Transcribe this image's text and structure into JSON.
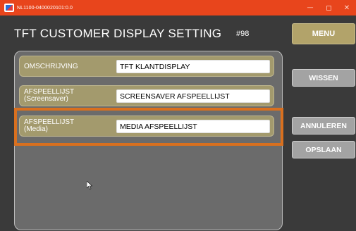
{
  "window": {
    "title": "NL1100-0400020101:0.0",
    "controls": {
      "minimize": "—",
      "close": "✕"
    }
  },
  "header": {
    "title": "TFT CUSTOMER DISPLAY SETTING",
    "number": "#98",
    "menu_label": "MENU"
  },
  "fields": [
    {
      "label": "OMSCHRIJVING",
      "sublabel": "",
      "value": "TFT KLANTDISPLAY"
    },
    {
      "label": "AFSPEELLIJST",
      "sublabel": "(Screensaver)",
      "value": "SCREENSAVER AFSPEELLIJST"
    },
    {
      "label": "AFSPEELLIJST",
      "sublabel": "(Media)",
      "value": "MEDIA AFSPEELLIJST"
    }
  ],
  "side_buttons": {
    "wissen": "WISSEN",
    "annuleren": "ANNULEREN",
    "opslaan": "OPSLAAN"
  },
  "selected_field_index": 2,
  "colors": {
    "titlebar": "#e8451c",
    "menu_button": "#b2a36a",
    "field_row": "#a39a6d",
    "highlight": "#d9701f",
    "panel": "#6b6b6b"
  }
}
